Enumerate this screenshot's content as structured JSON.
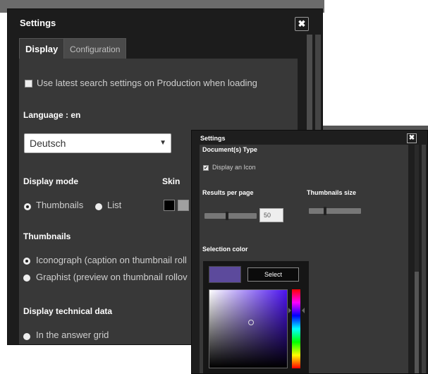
{
  "settings_window": {
    "title": "Settings",
    "close_label": "✖",
    "tabs": [
      {
        "label": "Display",
        "active": true
      },
      {
        "label": "Configuration",
        "active": false
      }
    ],
    "use_latest_search_label": "Use latest search settings on Production when loading",
    "use_latest_search_checked": false,
    "language_label": "Language : en",
    "language_select_value": "Deutsch",
    "display_mode": {
      "label": "Display mode",
      "options": [
        {
          "label": "Thumbnails",
          "selected": true
        },
        {
          "label": "List",
          "selected": false
        }
      ]
    },
    "skin": {
      "label": "Skin",
      "swatches": [
        "#000000",
        "#a0a0a0"
      ]
    },
    "thumbnails": {
      "label": "Thumbnails",
      "options": [
        {
          "label": "Iconograph (caption on thumbnail roll",
          "selected": true
        },
        {
          "label": "Graphist (preview on thumbnail rollov",
          "selected": false
        }
      ]
    },
    "technical_data": {
      "label": "Display technical data",
      "options": [
        {
          "label": "In the answer grid",
          "selected": false
        }
      ]
    }
  },
  "settings_window_2": {
    "title": "Settings",
    "close_label": "✖",
    "documents_type_label": "Document(s) Type",
    "display_icon_label": "Display an Icon",
    "display_icon_checked": true,
    "results_per_page_label": "Results per page",
    "results_per_page_value": "50",
    "thumbnails_size_label": "Thumbnails size",
    "selection_color_label": "Selection color",
    "select_button_label": "Select",
    "selected_color": "#5c4a9c"
  },
  "colors": {
    "window_bg": "#1c1c1c",
    "panel_bg": "#383838",
    "accent_purple": "#5c4a9c"
  }
}
